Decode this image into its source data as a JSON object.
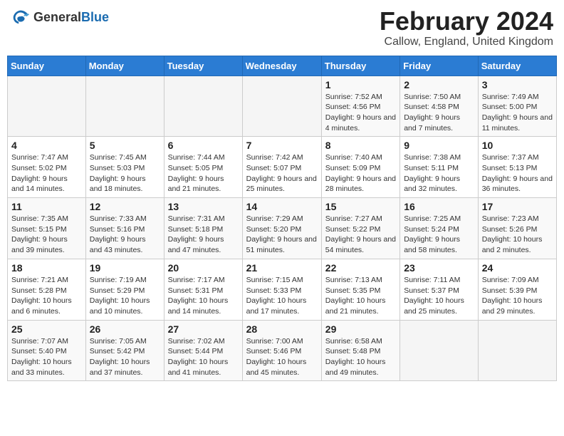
{
  "header": {
    "logo_general": "General",
    "logo_blue": "Blue",
    "month_year": "February 2024",
    "location": "Callow, England, United Kingdom"
  },
  "days_of_week": [
    "Sunday",
    "Monday",
    "Tuesday",
    "Wednesday",
    "Thursday",
    "Friday",
    "Saturday"
  ],
  "weeks": [
    [
      {
        "day": "",
        "text": ""
      },
      {
        "day": "",
        "text": ""
      },
      {
        "day": "",
        "text": ""
      },
      {
        "day": "",
        "text": ""
      },
      {
        "day": "1",
        "text": "Sunrise: 7:52 AM\nSunset: 4:56 PM\nDaylight: 9 hours and 4 minutes."
      },
      {
        "day": "2",
        "text": "Sunrise: 7:50 AM\nSunset: 4:58 PM\nDaylight: 9 hours and 7 minutes."
      },
      {
        "day": "3",
        "text": "Sunrise: 7:49 AM\nSunset: 5:00 PM\nDaylight: 9 hours and 11 minutes."
      }
    ],
    [
      {
        "day": "4",
        "text": "Sunrise: 7:47 AM\nSunset: 5:02 PM\nDaylight: 9 hours and 14 minutes."
      },
      {
        "day": "5",
        "text": "Sunrise: 7:45 AM\nSunset: 5:03 PM\nDaylight: 9 hours and 18 minutes."
      },
      {
        "day": "6",
        "text": "Sunrise: 7:44 AM\nSunset: 5:05 PM\nDaylight: 9 hours and 21 minutes."
      },
      {
        "day": "7",
        "text": "Sunrise: 7:42 AM\nSunset: 5:07 PM\nDaylight: 9 hours and 25 minutes."
      },
      {
        "day": "8",
        "text": "Sunrise: 7:40 AM\nSunset: 5:09 PM\nDaylight: 9 hours and 28 minutes."
      },
      {
        "day": "9",
        "text": "Sunrise: 7:38 AM\nSunset: 5:11 PM\nDaylight: 9 hours and 32 minutes."
      },
      {
        "day": "10",
        "text": "Sunrise: 7:37 AM\nSunset: 5:13 PM\nDaylight: 9 hours and 36 minutes."
      }
    ],
    [
      {
        "day": "11",
        "text": "Sunrise: 7:35 AM\nSunset: 5:15 PM\nDaylight: 9 hours and 39 minutes."
      },
      {
        "day": "12",
        "text": "Sunrise: 7:33 AM\nSunset: 5:16 PM\nDaylight: 9 hours and 43 minutes."
      },
      {
        "day": "13",
        "text": "Sunrise: 7:31 AM\nSunset: 5:18 PM\nDaylight: 9 hours and 47 minutes."
      },
      {
        "day": "14",
        "text": "Sunrise: 7:29 AM\nSunset: 5:20 PM\nDaylight: 9 hours and 51 minutes."
      },
      {
        "day": "15",
        "text": "Sunrise: 7:27 AM\nSunset: 5:22 PM\nDaylight: 9 hours and 54 minutes."
      },
      {
        "day": "16",
        "text": "Sunrise: 7:25 AM\nSunset: 5:24 PM\nDaylight: 9 hours and 58 minutes."
      },
      {
        "day": "17",
        "text": "Sunrise: 7:23 AM\nSunset: 5:26 PM\nDaylight: 10 hours and 2 minutes."
      }
    ],
    [
      {
        "day": "18",
        "text": "Sunrise: 7:21 AM\nSunset: 5:28 PM\nDaylight: 10 hours and 6 minutes."
      },
      {
        "day": "19",
        "text": "Sunrise: 7:19 AM\nSunset: 5:29 PM\nDaylight: 10 hours and 10 minutes."
      },
      {
        "day": "20",
        "text": "Sunrise: 7:17 AM\nSunset: 5:31 PM\nDaylight: 10 hours and 14 minutes."
      },
      {
        "day": "21",
        "text": "Sunrise: 7:15 AM\nSunset: 5:33 PM\nDaylight: 10 hours and 17 minutes."
      },
      {
        "day": "22",
        "text": "Sunrise: 7:13 AM\nSunset: 5:35 PM\nDaylight: 10 hours and 21 minutes."
      },
      {
        "day": "23",
        "text": "Sunrise: 7:11 AM\nSunset: 5:37 PM\nDaylight: 10 hours and 25 minutes."
      },
      {
        "day": "24",
        "text": "Sunrise: 7:09 AM\nSunset: 5:39 PM\nDaylight: 10 hours and 29 minutes."
      }
    ],
    [
      {
        "day": "25",
        "text": "Sunrise: 7:07 AM\nSunset: 5:40 PM\nDaylight: 10 hours and 33 minutes."
      },
      {
        "day": "26",
        "text": "Sunrise: 7:05 AM\nSunset: 5:42 PM\nDaylight: 10 hours and 37 minutes."
      },
      {
        "day": "27",
        "text": "Sunrise: 7:02 AM\nSunset: 5:44 PM\nDaylight: 10 hours and 41 minutes."
      },
      {
        "day": "28",
        "text": "Sunrise: 7:00 AM\nSunset: 5:46 PM\nDaylight: 10 hours and 45 minutes."
      },
      {
        "day": "29",
        "text": "Sunrise: 6:58 AM\nSunset: 5:48 PM\nDaylight: 10 hours and 49 minutes."
      },
      {
        "day": "",
        "text": ""
      },
      {
        "day": "",
        "text": ""
      }
    ]
  ]
}
